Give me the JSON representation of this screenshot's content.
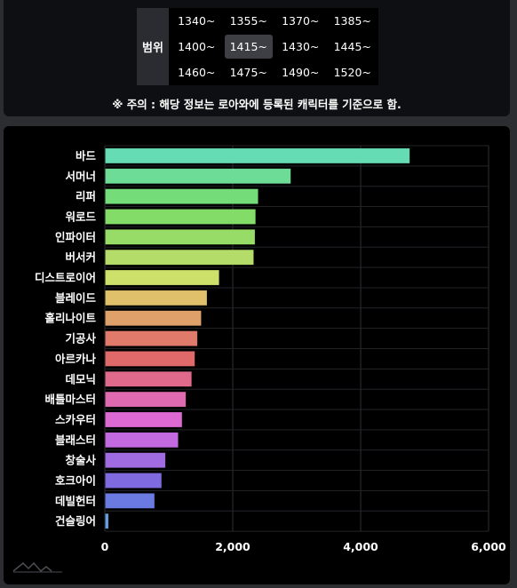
{
  "filter": {
    "range_label": "범위",
    "ranges": [
      "1340~",
      "1355~",
      "1370~",
      "1385~",
      "1400~",
      "1415~",
      "1430~",
      "1445~",
      "1460~",
      "1475~",
      "1490~",
      "1520~"
    ],
    "selected": "1415~",
    "notice": "※ 주의 : 해당 정보는 로아와에 등록된 캐릭터를 기준으로 함."
  },
  "chart_data": {
    "type": "bar",
    "orientation": "horizontal",
    "categories": [
      "바드",
      "서머너",
      "리퍼",
      "워로드",
      "인파이터",
      "버서커",
      "디스트로이어",
      "블레이드",
      "홀리나이트",
      "기공사",
      "아르카나",
      "데모닉",
      "배틀마스터",
      "스카우터",
      "블래스터",
      "창술사",
      "호크아이",
      "데빌헌터",
      "건슬링어"
    ],
    "values": [
      4760,
      2900,
      2390,
      2350,
      2340,
      2320,
      1780,
      1590,
      1500,
      1440,
      1400,
      1350,
      1260,
      1200,
      1140,
      940,
      880,
      770,
      50
    ],
    "colors": [
      "#66dcb4",
      "#6cdc96",
      "#74dc78",
      "#84dc68",
      "#98dc68",
      "#b4dc68",
      "#cce06a",
      "#e0c06a",
      "#e0a06a",
      "#e07a6a",
      "#e06a6a",
      "#e06a8c",
      "#e06ab0",
      "#dc6ad2",
      "#c46ae0",
      "#a06ae0",
      "#806ae0",
      "#6a7ae0",
      "#6a9ee0",
      "#6ac6e0"
    ],
    "xticks": [
      0,
      2000,
      4000,
      6000
    ],
    "xtick_labels": [
      "0",
      "2,000",
      "4,000",
      "6,000"
    ],
    "xlim": [
      0,
      6000
    ],
    "grid": true,
    "title": "",
    "xlabel": "",
    "ylabel": ""
  },
  "logo": {
    "icon": "mountain-logo-icon"
  }
}
